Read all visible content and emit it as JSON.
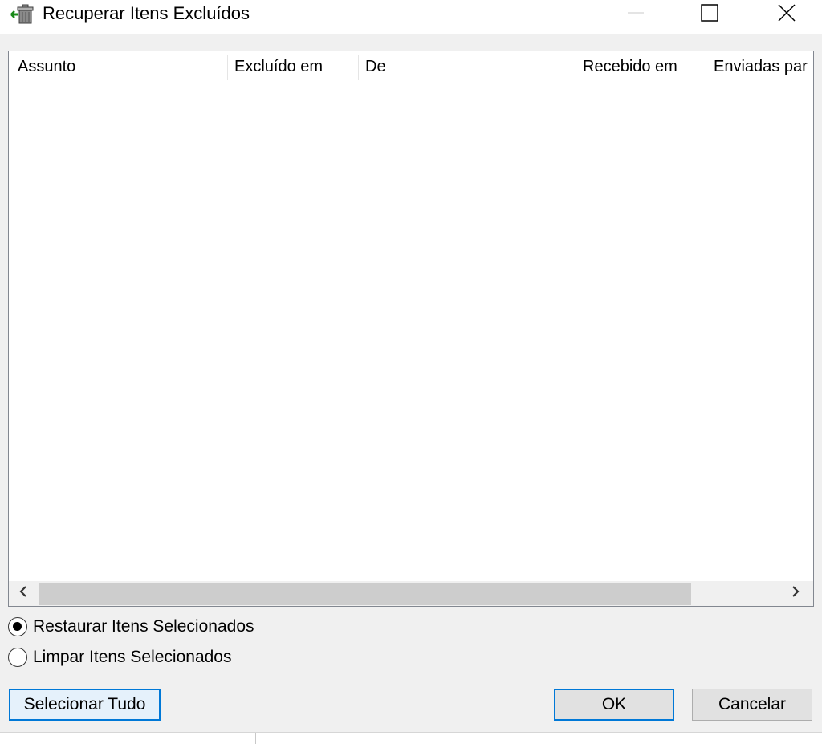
{
  "window": {
    "title": "Recuperar Itens Excluídos"
  },
  "listview": {
    "columns": [
      {
        "label": "Assunto"
      },
      {
        "label": "Excluído em"
      },
      {
        "label": "De"
      },
      {
        "label": "Recebido em"
      },
      {
        "label": "Enviadas par"
      }
    ],
    "rows": []
  },
  "options": {
    "restore_label": "Restaurar Itens Selecionados",
    "purge_label": "Limpar Itens Selecionados",
    "selected": "restore"
  },
  "buttons": {
    "select_all": "Selecionar Tudo",
    "ok": "OK",
    "cancel": "Cancelar"
  },
  "colors": {
    "accent": "#0078d7",
    "dialog_bg": "#f0f0f0",
    "scroll_thumb": "#cdcdcd"
  },
  "icons": {
    "app": "recover-deleted-items-icon",
    "minimize": "minimize-icon",
    "maximize": "maximize-icon",
    "close": "close-icon",
    "scroll_left": "chevron-left-icon",
    "scroll_right": "chevron-right-icon"
  }
}
